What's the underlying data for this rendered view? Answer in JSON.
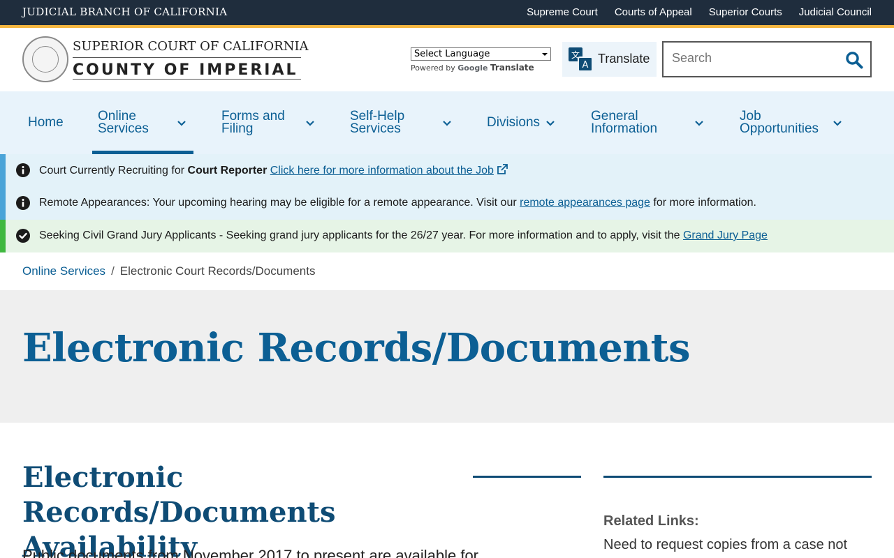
{
  "topbar": {
    "brand": "JUDICIAL BRANCH OF CALIFORNIA",
    "links": [
      "Supreme Court",
      "Courts of Appeal",
      "Superior Courts",
      "Judicial Council"
    ]
  },
  "header": {
    "logo_line1": "SUPERIOR COURT OF CALIFORNIA",
    "logo_line2": "COUNTY OF IMPERIAL",
    "language_select": "Select Language",
    "powered_by": "Powered by",
    "google": "Google",
    "translate_word": "Translate",
    "translate_button": "Translate",
    "search_placeholder": "Search"
  },
  "nav": {
    "items": [
      {
        "label": "Home"
      },
      {
        "label": "Online Services"
      },
      {
        "label": "Forms and Filing"
      },
      {
        "label": "Self-Help Services"
      },
      {
        "label": "Divisions"
      },
      {
        "label": "General Information"
      },
      {
        "label": "Job Opportunities"
      }
    ]
  },
  "alerts": [
    {
      "text": "Court Currently Recruiting for ",
      "bold": "Court Reporter",
      "link": "Click here for more information about the Job"
    },
    {
      "text": "Remote Appearances: Your upcoming hearing may be eligible for a remote appearance. Visit our ",
      "link": "remote appearances page",
      "after": " for more information."
    },
    {
      "text": "Seeking Civil Grand Jury Applicants - Seeking grand jury applicants for the 26/27 year. For more information and to apply, visit the ",
      "link": "Grand Jury Page"
    }
  ],
  "breadcrumb": {
    "parent": "Online Services",
    "separator": "/",
    "current": "Electronic Court Records/Documents"
  },
  "hero": {
    "title": "Electronic Records/Documents"
  },
  "content": {
    "section_title": "Electronic Records/Documents Availability",
    "body_text": "Public documents from November 2017 to present are available for"
  },
  "sidebar": {
    "heading": "Related Links:",
    "text": "Need to request copies from a case not"
  },
  "colors": {
    "topbar": "#1f2d3d",
    "gold": "#f5b640",
    "primary": "#0c5f94",
    "nav_bg": "#e8f3fb",
    "info_bg": "#e3f2f9",
    "success_bg": "#e6f4e6"
  },
  "icons": [
    "seal-logo",
    "translate-icon",
    "search-icon",
    "chevron-down-icon",
    "info-icon",
    "check-circle-icon",
    "external-link-icon"
  ]
}
